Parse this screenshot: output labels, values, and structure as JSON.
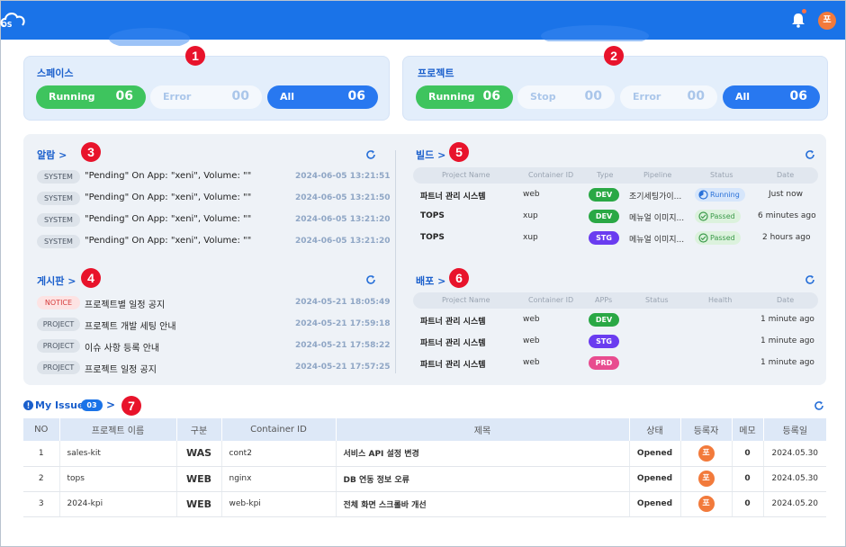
{
  "header": {
    "logo_text": "OS",
    "avatar_initial": "포"
  },
  "markers": [
    "1",
    "2",
    "3",
    "4",
    "5",
    "6",
    "7"
  ],
  "space": {
    "title": "스페이스",
    "stats": [
      {
        "label": "Running",
        "value": "06"
      },
      {
        "label": "Error",
        "value": "00"
      },
      {
        "label": "All",
        "value": "06"
      }
    ]
  },
  "project": {
    "title": "프로젝트",
    "stats": [
      {
        "label": "Running",
        "value": "06"
      },
      {
        "label": "Stop",
        "value": "00"
      },
      {
        "label": "Error",
        "value": "00"
      },
      {
        "label": "All",
        "value": "06"
      }
    ]
  },
  "alarms": {
    "title": "알람 >",
    "items": [
      {
        "tag": "SYSTEM",
        "message": "\"Pending\" On App: \"xeni\", Volume: \"\"",
        "time": "2024-06-05 13:21:51"
      },
      {
        "tag": "SYSTEM",
        "message": "\"Pending\" On App: \"xeni\", Volume: \"\"",
        "time": "2024-06-05 13:21:50"
      },
      {
        "tag": "SYSTEM",
        "message": "\"Pending\" On App: \"xeni\", Volume: \"\"",
        "time": "2024-06-05 13:21:20"
      },
      {
        "tag": "SYSTEM",
        "message": "\"Pending\" On App: \"xeni\", Volume: \"\"",
        "time": "2024-06-05 13:21:20"
      }
    ]
  },
  "board": {
    "title": "게시판 >",
    "items": [
      {
        "tag": "NOTICE",
        "message": "프로젝트별 일정 공지",
        "time": "2024-05-21 18:05:49"
      },
      {
        "tag": "PROJECT",
        "message": "프로젝트 개발 세팅 안내",
        "time": "2024-05-21 17:59:18"
      },
      {
        "tag": "PROJECT",
        "message": "이슈 사항 등록 안내",
        "time": "2024-05-21 17:58:22"
      },
      {
        "tag": "PROJECT",
        "message": "프로젝트 일정 공지",
        "time": "2024-05-21 17:57:25"
      }
    ]
  },
  "build": {
    "title": "빌드 >",
    "columns": [
      "Project Name",
      "Container ID",
      "Type",
      "Pipeline",
      "Status",
      "Date"
    ],
    "rows": [
      {
        "project": "파트너 관리 시스템",
        "container": "web",
        "type": "DEV",
        "pipeline": "조기세팅가이...",
        "status": "Running",
        "date": "Just now"
      },
      {
        "project": "TOPS",
        "container": "xup",
        "type": "DEV",
        "pipeline": "메뉴얼 이미지...",
        "status": "Passed",
        "date": "6 minutes ago"
      },
      {
        "project": "TOPS",
        "container": "xup",
        "type": "STG",
        "pipeline": "메뉴얼 이미지...",
        "status": "Passed",
        "date": "2 hours ago"
      }
    ]
  },
  "deploy": {
    "title": "배포 >",
    "columns": [
      "Project Name",
      "Container ID",
      "APPs",
      "Status",
      "Health",
      "Date"
    ],
    "rows": [
      {
        "project": "파트너 관리 시스템",
        "container": "web",
        "app": "DEV",
        "date": "1 minute ago"
      },
      {
        "project": "파트너 관리 시스템",
        "container": "web",
        "app": "STG",
        "date": "1 minute ago"
      },
      {
        "project": "파트너 관리 시스템",
        "container": "web",
        "app": "PRD",
        "date": "1 minute ago"
      }
    ]
  },
  "issues": {
    "title": "My Issue",
    "count": "03",
    "arrow": ">",
    "columns": [
      "NO",
      "프로젝트 이름",
      "구분",
      "Container ID",
      "제목",
      "상태",
      "등록자",
      "메모",
      "등록일"
    ],
    "rows": [
      {
        "no": "1",
        "project": "sales-kit",
        "type": "WAS",
        "container": "cont2",
        "title": "서비스 API 설정 변경",
        "status": "Opened",
        "author": "포",
        "memo": "0",
        "date": "2024.05.30"
      },
      {
        "no": "2",
        "project": "tops",
        "type": "WEB",
        "container": "nginx",
        "title": "DB 연동 정보 오류",
        "status": "Opened",
        "author": "포",
        "memo": "0",
        "date": "2024.05.30"
      },
      {
        "no": "3",
        "project": "2024-kpi",
        "type": "WEB",
        "container": "web-kpi",
        "title": "전체 화면 스크롤바 개선",
        "status": "Opened",
        "author": "포",
        "memo": "0",
        "date": "2024.05.20"
      }
    ]
  }
}
